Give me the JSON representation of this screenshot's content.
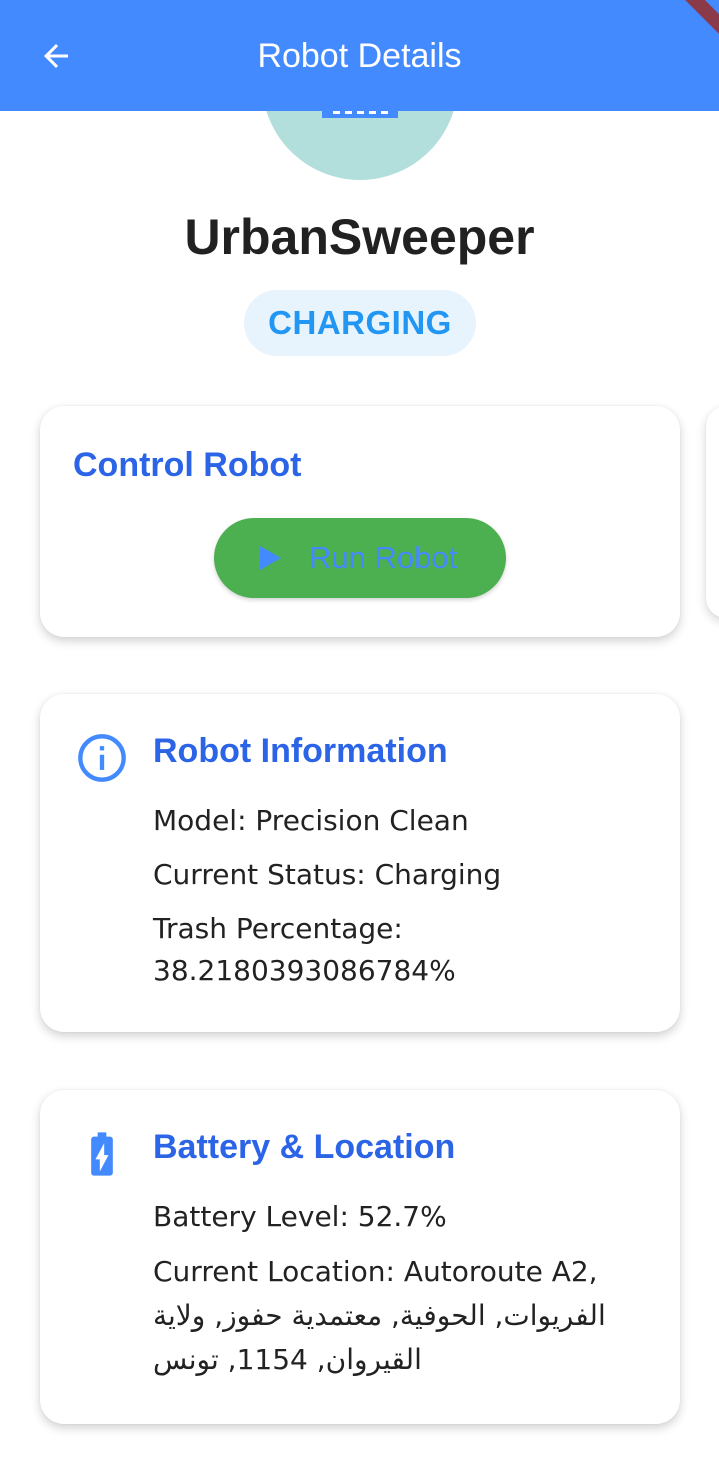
{
  "app_bar": {
    "title": "Robot Details",
    "back_icon": "arrow-left-icon",
    "color": "#448aff"
  },
  "robot": {
    "name": "UrbanSweeper",
    "status_chip": "CHARGING",
    "avatar_color": "#b2dfdb"
  },
  "control_card": {
    "title": "Control Robot",
    "run_button_label": "Run Robot",
    "run_button_icon": "play-icon",
    "run_button_color": "#4caf50"
  },
  "info_card": {
    "icon": "info-icon",
    "title": "Robot Information",
    "model": "Model: Precision Clean",
    "current_status": "Current Status: Charging",
    "trash_label": "Trash Percentage:",
    "trash_value": "38.2180393086784%"
  },
  "battery_card": {
    "icon": "battery-charging-icon",
    "title": "Battery & Location",
    "battery_level": "Battery Level: 52.7%",
    "location_line1": "Current Location: Autoroute A2,",
    "location_line2": "الفريوات, الحوفية, معتمدية حفوز, ولاية",
    "location_line3": "القيروان, 1154, تونس"
  },
  "colors": {
    "accent": "#2b64e6",
    "chip_text": "#2196f3",
    "chip_bg": "#e7f3fd"
  }
}
